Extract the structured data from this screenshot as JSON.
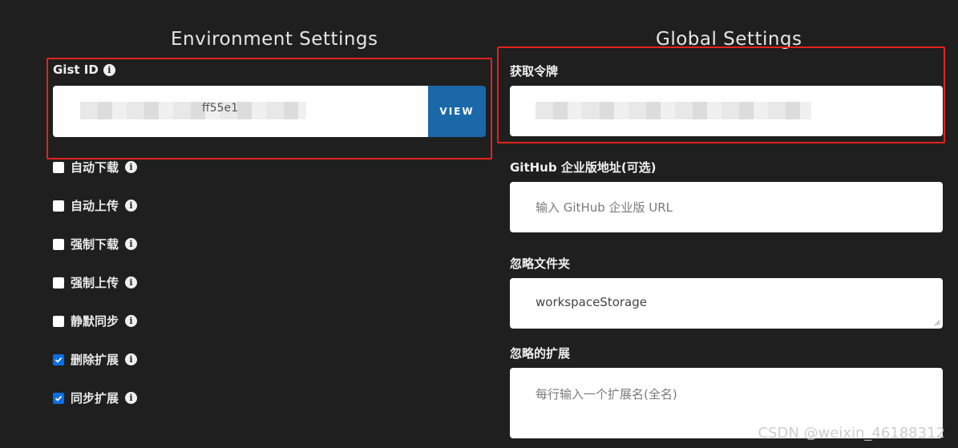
{
  "left": {
    "heading": "Environment Settings",
    "gist": {
      "label": "Gist ID",
      "view_label": "VIEW",
      "value_visible": "ff55e1"
    },
    "checkboxes": [
      {
        "label": "自动下载",
        "checked": false
      },
      {
        "label": "自动上传",
        "checked": false
      },
      {
        "label": "强制下载",
        "checked": false
      },
      {
        "label": "强制上传",
        "checked": false
      },
      {
        "label": "静默同步",
        "checked": false
      },
      {
        "label": "删除扩展",
        "checked": true
      },
      {
        "label": "同步扩展",
        "checked": true
      }
    ]
  },
  "right": {
    "heading": "Global Settings",
    "token": {
      "label": "获取令牌"
    },
    "github_enterprise": {
      "label": "GitHub 企业版地址(可选)",
      "placeholder": "输入 GitHub 企业版 URL"
    },
    "ignore_folders": {
      "label": "忽略文件夹",
      "value": "workspaceStorage"
    },
    "ignore_extensions": {
      "label": "忽略的扩展",
      "placeholder": "每行输入一个扩展名(全名)"
    }
  },
  "watermark": "CSDN @weixin_46188312",
  "colors": {
    "background": "#1f1f1f",
    "accent": "#1a68a8",
    "highlight": "#e3231c",
    "checkbox_checked": "#0a6ee6"
  }
}
